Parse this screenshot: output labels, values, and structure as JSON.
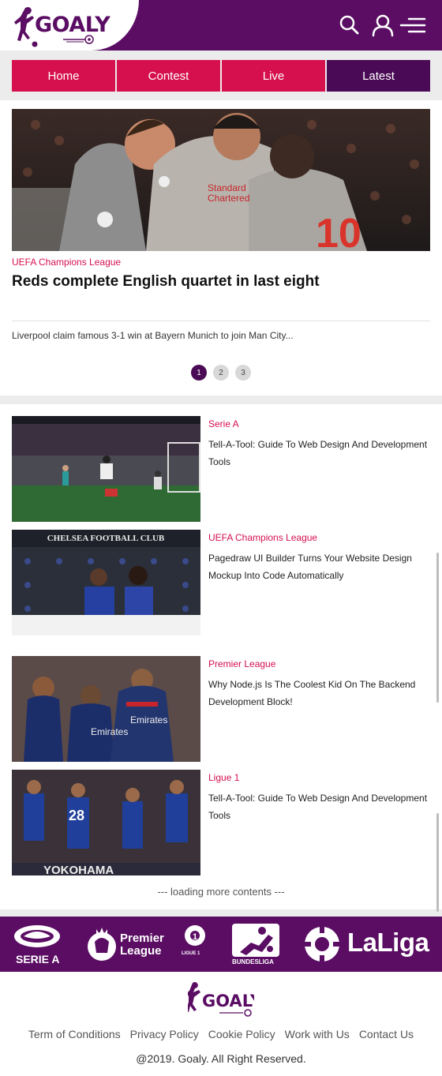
{
  "brand": {
    "name": "GOALY"
  },
  "header": {
    "icons": [
      "search-icon",
      "user-icon",
      "menu-icon"
    ]
  },
  "nav": {
    "items": [
      {
        "label": "Home"
      },
      {
        "label": "Contest"
      },
      {
        "label": "Live"
      },
      {
        "label": "Latest"
      }
    ],
    "active": "Latest"
  },
  "hero": {
    "category": "UEFA Champions League",
    "title": "Reds complete English quartet in last eight",
    "description": "Liverpool claim famous 3-1 win at Bayern Munich to join Man City...",
    "pages": [
      "1",
      "2",
      "3"
    ],
    "active_page": "1"
  },
  "news": [
    {
      "category": "Serie A",
      "title": "Tell-A-Tool: Guide To Web Design And Development Tools"
    },
    {
      "category": "UEFA Champions League",
      "title": "Pagedraw UI Builder Turns Your Website Design Mockup Into Code Automatically"
    },
    {
      "category": "Premier League",
      "title": "Why Node.js Is The Coolest Kid On The Backend Development Block!"
    },
    {
      "category": "Ligue 1",
      "title": "Tell-A-Tool: Guide To Web Design And Development Tools"
    }
  ],
  "loading_text": "--- loading more contents ---",
  "leagues": {
    "serie_a": "SERIE A",
    "premier": [
      "Premier",
      "League"
    ],
    "ligue": "LIGUE 1",
    "bundesliga": "BUNDESLIGA",
    "laliga": "LaLiga"
  },
  "footer": {
    "links": [
      "Term of Conditions",
      "Privacy Policy",
      "Cookie Policy",
      "Work with Us",
      "Contact Us"
    ],
    "copyright": "@2019. Goaly. All Right Reserved."
  },
  "colors": {
    "brand_purple": "#5a0d63",
    "accent_pink": "#d6104f",
    "dark_purple": "#4b0a55"
  }
}
